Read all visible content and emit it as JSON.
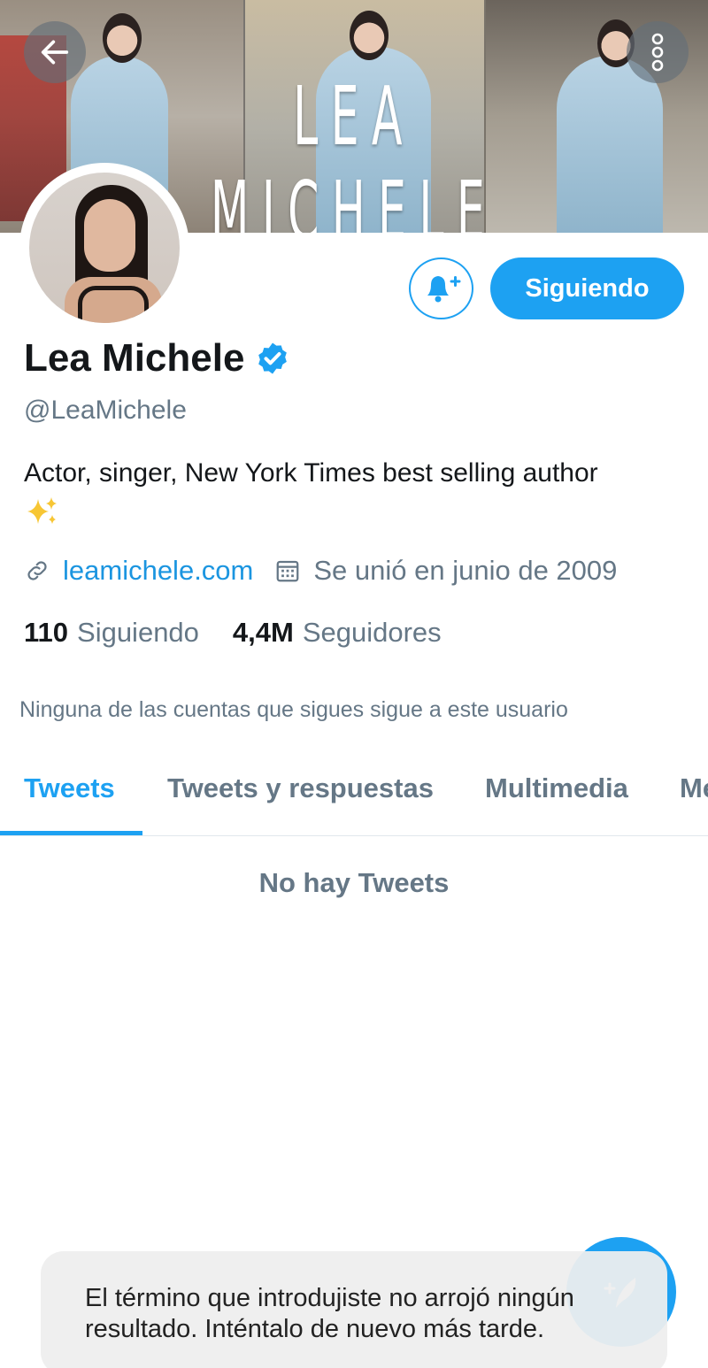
{
  "banner": {
    "title": "LEA MICHELE"
  },
  "icons": {
    "back": "arrow-left-icon",
    "more": "more-vertical-icon",
    "bell": "bell-plus-icon",
    "verified": "verified-badge-icon",
    "link": "link-icon",
    "calendar": "calendar-icon",
    "compose": "compose-tweet-icon",
    "sparkle": "sparkles-emoji"
  },
  "colors": {
    "accent": "#1da1f2",
    "muted": "#657786",
    "text": "#14171a"
  },
  "profile": {
    "follow_button": "Siguiendo",
    "name": "Lea Michele",
    "handle": "@LeaMichele",
    "bio": "Actor, singer, New York Times best selling author",
    "bio_emoji": "✨",
    "website": "leamichele.com",
    "joined": "Se unió en junio de 2009",
    "following_count": "110",
    "following_label": "Siguiendo",
    "followers_count": "4,4M",
    "followers_label": "Seguidores",
    "mutuals_text": "Ninguna de las cuentas que sigues sigue a este usuario"
  },
  "tabs": [
    {
      "label": "Tweets",
      "active": true
    },
    {
      "label": "Tweets y respuestas",
      "active": false
    },
    {
      "label": "Multimedia",
      "active": false
    },
    {
      "label": "Me",
      "active": false
    }
  ],
  "timeline": {
    "empty_text": "No hay Tweets"
  },
  "toast": {
    "message": "El término que introdujiste no arrojó ningún resultado. Inténtalo de nuevo más tarde."
  }
}
